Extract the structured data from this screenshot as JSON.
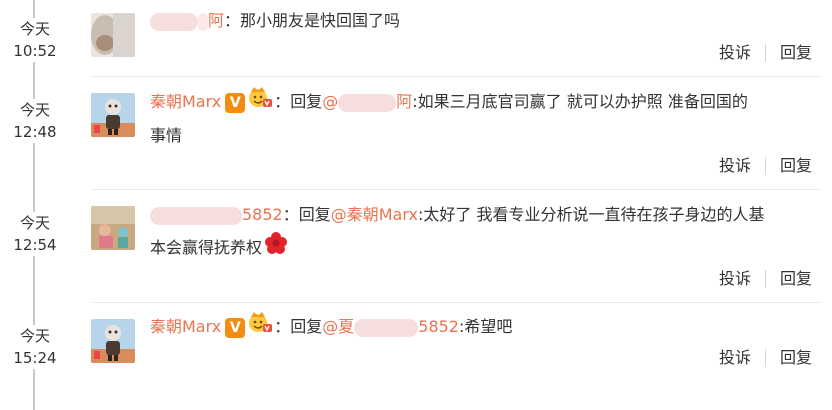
{
  "comments": [
    {
      "time_day": "今天",
      "time_clock": "10:52",
      "prefix": "阿",
      "text": "：那小朋友是快回国了吗",
      "report_label": "投诉",
      "reply_label": "回复"
    },
    {
      "time_day": "今天",
      "time_clock": "12:48",
      "author": "秦朝Marx",
      "v_badge": "V",
      "reply_word": "：回复",
      "mention_start": "@",
      "mention_end": "阿",
      "text_line1": ":如果三月底官司赢了 就可以办护照 准备回国的",
      "text_line2": "事情",
      "report_label": "投诉",
      "reply_label": "回复"
    },
    {
      "time_day": "今天",
      "time_clock": "12:54",
      "author_tail": "5852",
      "reply_word": "：回复",
      "mention": "@秦朝Marx",
      "text_line1": ":太好了 我看专业分析说一直待在孩子身边的人基",
      "text_line2": "本会赢得抚养权",
      "report_label": "投诉",
      "reply_label": "回复"
    },
    {
      "time_day": "今天",
      "time_clock": "15:24",
      "author": "秦朝Marx",
      "v_badge": "V",
      "reply_word": "：回复",
      "mention_start": "@夏",
      "mention_end": "5852",
      "text": ":希望吧",
      "report_label": "投诉",
      "reply_label": "回复"
    }
  ],
  "colors": {
    "accent": "#eb7350",
    "text": "#333333",
    "timeline": "#c9c9c9",
    "v_badge": "#f58c12",
    "flower": "#e0242a"
  }
}
